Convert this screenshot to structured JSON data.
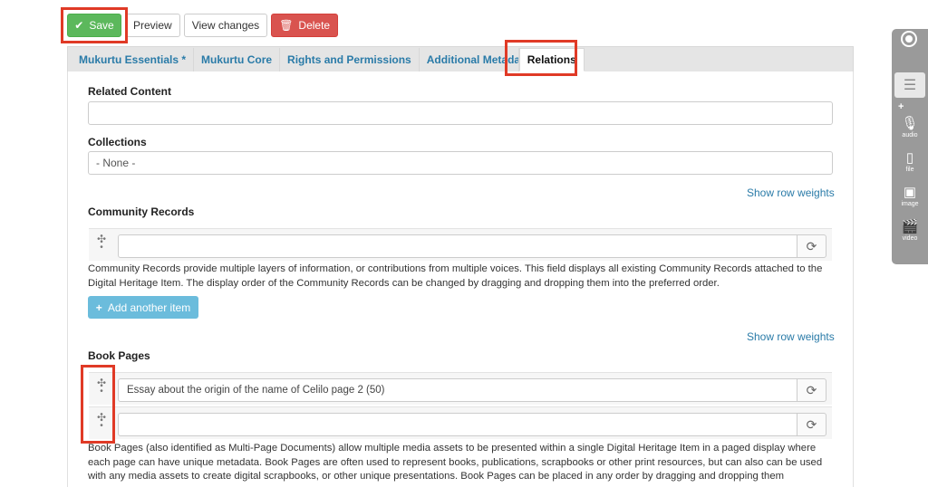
{
  "toolbar": {
    "save_label": "Save",
    "preview_label": "Preview",
    "view_changes_label": "View changes",
    "delete_label": "Delete"
  },
  "tabs": [
    {
      "label": "Mukurtu Essentials *"
    },
    {
      "label": "Mukurtu Core"
    },
    {
      "label": "Rights and Permissions"
    },
    {
      "label": "Additional Metadata"
    },
    {
      "label": "Relations"
    }
  ],
  "related_content": {
    "label": "Related Content",
    "value": ""
  },
  "collections": {
    "label": "Collections",
    "value": "- None -"
  },
  "community_records": {
    "show_weights": "Show row weights",
    "label": "Community Records",
    "rows": [
      {
        "value": ""
      }
    ],
    "description": "Community Records provide multiple layers of information, or contributions from multiple voices. This field displays all existing Community Records attached to the Digital Heritage Item. The display order of the Community Records can be changed by dragging and dropping them into the preferred order.",
    "add_label": "Add another item"
  },
  "book_pages": {
    "show_weights": "Show row weights",
    "label": "Book Pages",
    "rows": [
      {
        "value": "Essay about the origin of the name of Celilo page 2 (50)"
      },
      {
        "value": ""
      }
    ],
    "description": "Book Pages (also identified as Multi-Page Documents) allow multiple media assets to be presented within a single Digital Heritage Item in a paged display where each page can have unique metadata. Book Pages are often used to represent books, publications, scrapbooks or other print resources, but can also can be used with any media assets to create digital scrapbooks, or other unique presentations. Book Pages can be placed in any order by dragging and dropping them"
  },
  "sidebar": {
    "items": [
      {
        "label": "audio",
        "icon": "microphone-icon"
      },
      {
        "label": "file",
        "icon": "file-icon"
      },
      {
        "label": "image",
        "icon": "image-icon"
      },
      {
        "label": "video",
        "icon": "clapperboard-icon"
      }
    ]
  },
  "colors": {
    "save": "#5cb85c",
    "delete": "#d9534f",
    "link": "#2a7ba8",
    "highlight": "#e03a26",
    "add_button": "#6bbcdc"
  }
}
